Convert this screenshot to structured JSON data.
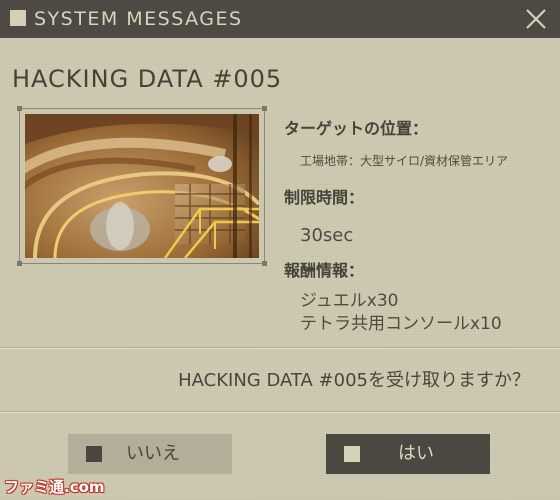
{
  "window": {
    "title": "SYSTEM MESSAGES",
    "close_icon": "close-x-icon"
  },
  "message": {
    "heading": "HACKING DATA #005",
    "image_icon": "target-location-screenshot"
  },
  "details": {
    "location_label": "ターゲットの位置：",
    "location_value": "工場地帯：大型サイロ/資材保管エリア",
    "time_label": "制限時間：",
    "time_value": "30sec",
    "reward_label": "報酬情報：",
    "rewards": [
      "ジュエルx30",
      "テトラ共用コンソールx10"
    ]
  },
  "prompt": {
    "question": "HACKING DATA #005を受け取りますか？"
  },
  "buttons": {
    "no_label": "いいえ",
    "yes_label": "はい"
  },
  "watermark": {
    "text": "ファミ通.com"
  },
  "colors": {
    "panel": "#cdc8b0",
    "titlebar": "#4e4a43",
    "text_dark": "#45423a",
    "button_selected": "#4b4841",
    "button_unselected": "#b3ae99"
  }
}
